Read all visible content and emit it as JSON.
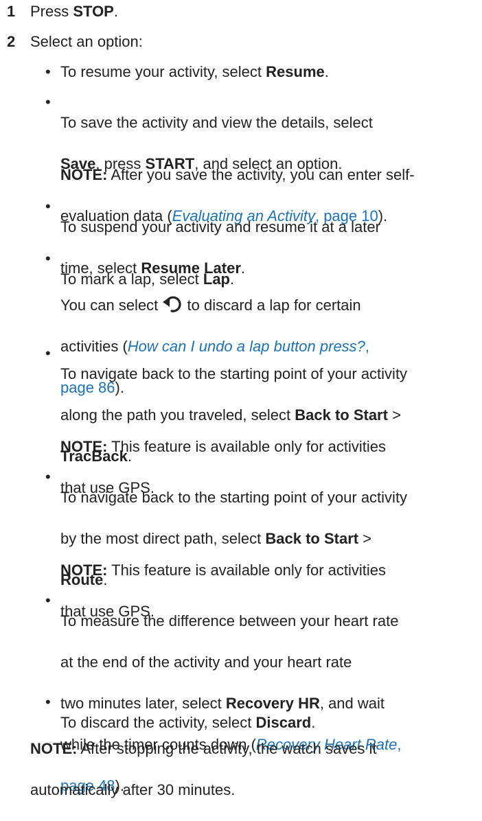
{
  "steps": [
    {
      "num": "1",
      "text": "Press ",
      "bold": "STOP",
      "tail": "."
    },
    {
      "num": "2",
      "text": "Select an option:"
    }
  ],
  "b1": {
    "pre": "To resume your activity, select ",
    "bold": "Resume",
    "post": "."
  },
  "b2": {
    "line1": "To save the activity and view the details, select",
    "save": "Save",
    "mid1": ", press ",
    "start": "START",
    "mid2": ", and select an option.",
    "note_label": "NOTE:",
    "note_text": " After you save the activity, you can enter self-",
    "note_line2_pre": "evaluation data (",
    "link_title": "Evaluating an Activity",
    "link_page": ", page 10",
    "note_line2_post": ")."
  },
  "b3": {
    "line1": "To suspend your activity and resume it at a later",
    "line2_pre": "time, select ",
    "bold": "Resume Later",
    "post": "."
  },
  "b4": {
    "pre": "To mark a lap, select ",
    "bold": "Lap",
    "post": ".",
    "l2a": "You can select ",
    "l2b": " to discard a lap for certain",
    "l3_pre": "activities (",
    "link_title": "How can I undo a lap button press?",
    "link_comma": ",",
    "link_page": "page 86",
    "l4_post": ")."
  },
  "b5": {
    "line1": "To navigate back to the starting point of your activity",
    "line2_pre": "along the path you traveled, select ",
    "bold1": "Back to Start",
    "gt": " >",
    "bold2": "TracBack",
    "post": ".",
    "note_label": "NOTE:",
    "note_text": " This feature is available only for activities",
    "note_line2": "that use GPS."
  },
  "b6": {
    "line1": "To navigate back to the starting point of your activity",
    "line2_pre": "by the most direct path, select ",
    "bold1": "Back to Start",
    "gt": " >",
    "bold2": "Route",
    "post": ".",
    "note_label": "NOTE:",
    "note_text": " This feature is available only for activities",
    "note_line2": "that use GPS."
  },
  "b7": {
    "line1": "To measure the difference between your heart rate",
    "line2": "at the end of the activity and your heart rate",
    "line3_pre": "two minutes later, select ",
    "bold": "Recovery HR",
    "line3_post": ", and wait",
    "line4_pre": "while the timer counts down (",
    "link_title": "Recovery Heart Rate",
    "link_comma": ",",
    "link_page": "page 48",
    "line5_post": ")."
  },
  "b8": {
    "pre": "To discard the activity, select ",
    "bold": "Discard",
    "post": "."
  },
  "final_note": {
    "label": "NOTE:",
    "text": " After stopping the activity, the watch saves it",
    "line2": "automatically after 30 minutes."
  },
  "bullet_char": "•",
  "colors": {
    "text": "#222222",
    "link": "#1a73b8"
  }
}
